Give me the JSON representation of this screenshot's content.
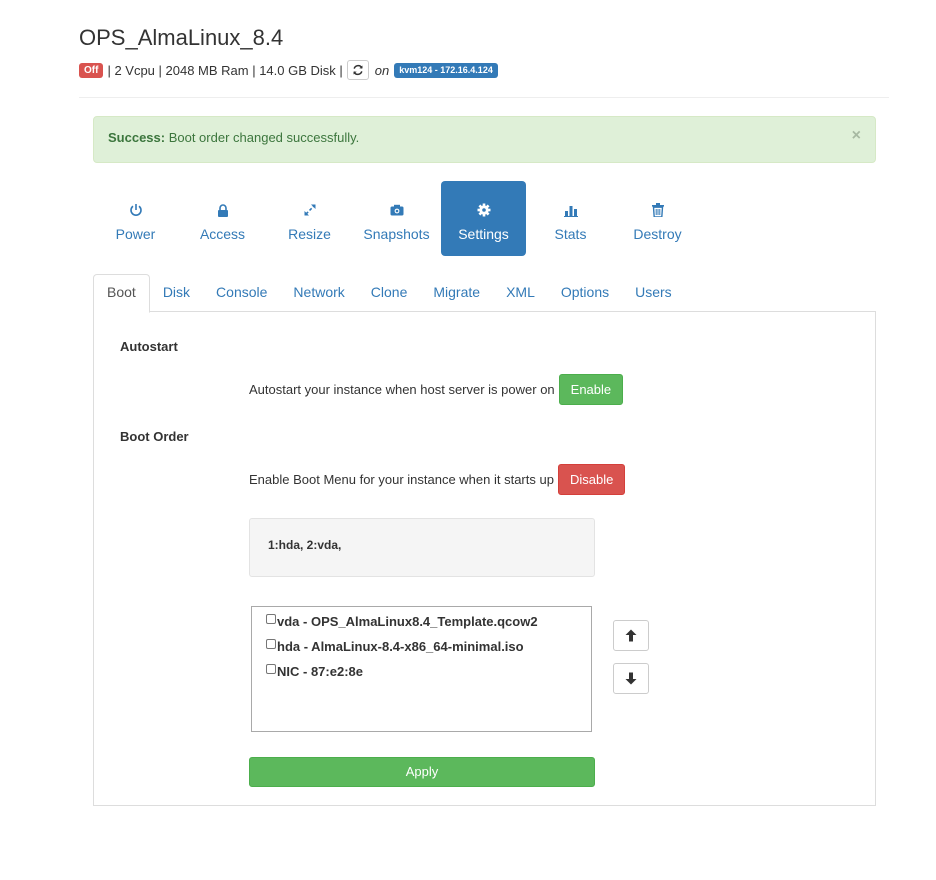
{
  "instance": {
    "title": "OPS_AlmaLinux_8.4",
    "status": "Off",
    "specs": "| 2 Vcpu | 2048 MB Ram | 14.0 GB Disk |",
    "on_text": "on",
    "host": "kvm124 - 172.16.4.124"
  },
  "alert": {
    "strong": "Success:",
    "message": " Boot order changed successfully.",
    "close": "×"
  },
  "actions": [
    {
      "label": "Power",
      "icon": "power-icon"
    },
    {
      "label": "Access",
      "icon": "lock-icon"
    },
    {
      "label": "Resize",
      "icon": "resize-icon"
    },
    {
      "label": "Snapshots",
      "icon": "camera-icon"
    },
    {
      "label": "Settings",
      "icon": "gear-icon",
      "active": true
    },
    {
      "label": "Stats",
      "icon": "stats-icon"
    },
    {
      "label": "Destroy",
      "icon": "trash-icon"
    }
  ],
  "tabs": [
    {
      "label": "Boot",
      "active": true
    },
    {
      "label": "Disk"
    },
    {
      "label": "Console"
    },
    {
      "label": "Network"
    },
    {
      "label": "Clone"
    },
    {
      "label": "Migrate"
    },
    {
      "label": "XML"
    },
    {
      "label": "Options"
    },
    {
      "label": "Users"
    }
  ],
  "boot": {
    "autostart_title": "Autostart",
    "autostart_text": "Autostart your instance when host server is power on",
    "autostart_button": "Enable",
    "boot_order_title": "Boot Order",
    "boot_menu_text": "Enable Boot Menu for your instance when it starts up",
    "boot_menu_button": "Disable",
    "current_order": "1:hda, 2:vda,",
    "devices": [
      {
        "label": "vda - OPS_AlmaLinux8.4_Template.qcow2",
        "checked": false
      },
      {
        "label": "hda - AlmaLinux-8.4-x86_64-minimal.iso",
        "checked": false
      },
      {
        "label": "NIC - 87:e2:8e",
        "checked": false
      }
    ],
    "apply_button": "Apply"
  },
  "colors": {
    "primary": "#337ab7",
    "success": "#5cb85c",
    "danger": "#d9534f",
    "alert_bg": "#dff0d8"
  }
}
